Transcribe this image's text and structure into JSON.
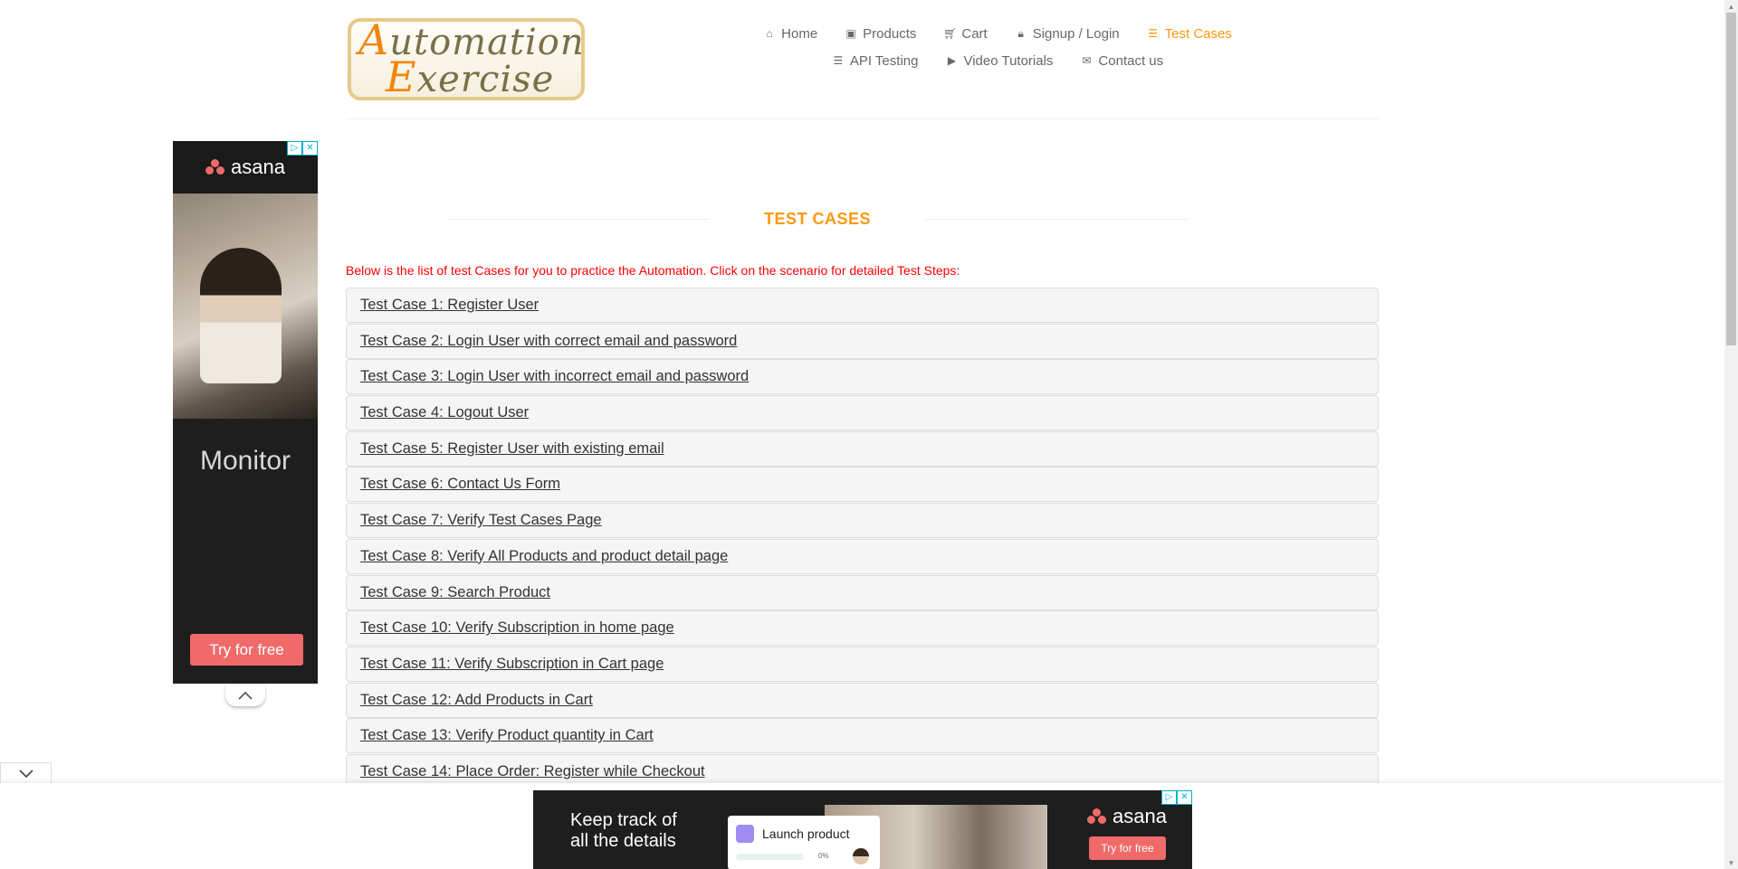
{
  "logo": {
    "line1_cap": "A",
    "line1_rest": "utomation",
    "line2_cap": "E",
    "line2_rest": "xercise"
  },
  "nav": [
    {
      "label": "Home",
      "icon": "home-icon",
      "glyph": "⌂",
      "active": false
    },
    {
      "label": "Products",
      "icon": "products-icon",
      "glyph": "▣",
      "active": false
    },
    {
      "label": "Cart",
      "icon": "cart-icon",
      "glyph": "🛒︎",
      "active": false
    },
    {
      "label": "Signup / Login",
      "icon": "lock-icon",
      "glyph": "🔒︎",
      "active": false
    },
    {
      "label": "Test Cases",
      "icon": "list-icon",
      "glyph": "☰",
      "active": true
    },
    {
      "label": "API Testing",
      "icon": "list-icon",
      "glyph": "☰",
      "active": false
    },
    {
      "label": "Video Tutorials",
      "icon": "youtube-icon",
      "glyph": "▶",
      "active": false
    },
    {
      "label": "Contact us",
      "icon": "envelope-icon",
      "glyph": "✉",
      "active": false
    }
  ],
  "page_title": "TEST CASES",
  "intro_text": "Below is the list of test Cases for you to practice the Automation. Click on the scenario for detailed Test Steps:",
  "test_cases": [
    "Test Case 1: Register User",
    "Test Case 2: Login User with correct email and password",
    "Test Case 3: Login User with incorrect email and password",
    "Test Case 4: Logout User",
    "Test Case 5: Register User with existing email",
    "Test Case 6: Contact Us Form",
    "Test Case 7: Verify Test Cases Page",
    "Test Case 8: Verify All Products and product detail page",
    "Test Case 9: Search Product",
    "Test Case 10: Verify Subscription in home page",
    "Test Case 11: Verify Subscription in Cart page",
    "Test Case 12: Add Products in Cart",
    "Test Case 13: Verify Product quantity in Cart",
    "Test Case 14: Place Order: Register while Checkout"
  ],
  "side_ad": {
    "brand": "asana",
    "headline": "Monitor",
    "cta": "Try for free"
  },
  "bottom_ad": {
    "headline_line1": "Keep track of",
    "headline_line2": "all the details",
    "card_title": "Launch product",
    "card_progress": "0%",
    "brand": "asana",
    "cta": "Try for free"
  },
  "colors": {
    "accent": "#fe980f",
    "intro": "#ff0000",
    "ad_cta": "#f06a6a"
  }
}
